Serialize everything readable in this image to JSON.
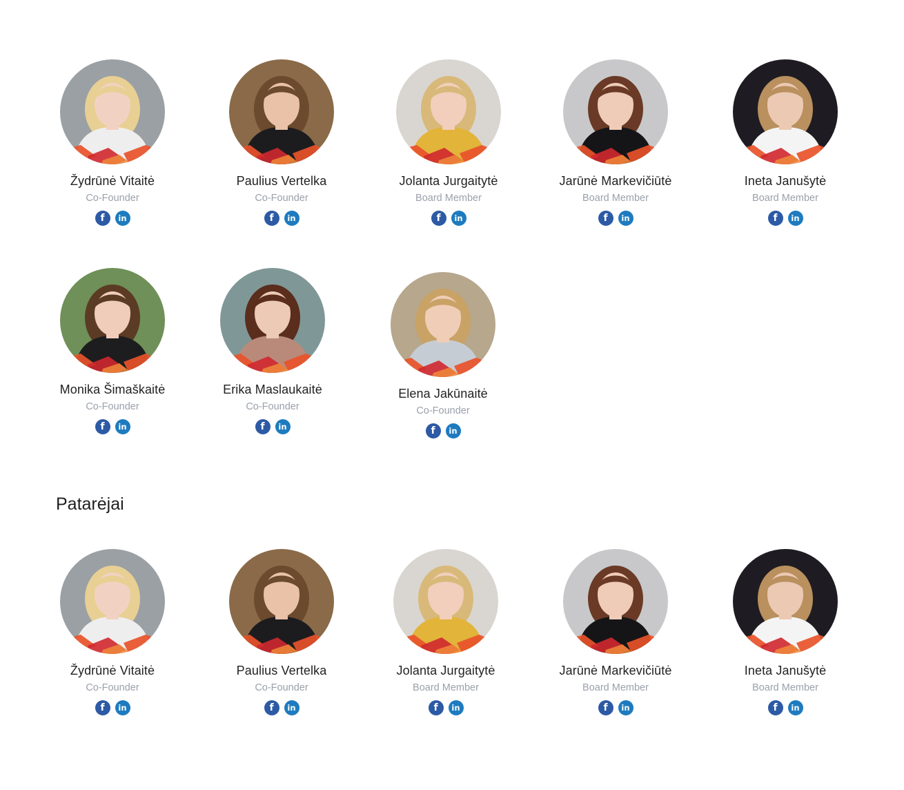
{
  "board": [
    {
      "name": "Žydrūnė Vitaitė",
      "role": "Co-Founder",
      "bg": "#9aa0a4",
      "skin": "#f1d2c2",
      "hair": "#e8cf93",
      "cloth": "#eeeeee"
    },
    {
      "name": "Paulius Vertelka",
      "role": "Co-Founder",
      "bg": "#8a6a48",
      "skin": "#e9c2a8",
      "hair": "#6b4a2d",
      "cloth": "#1c1c1f"
    },
    {
      "name": "Jolanta Jurgaitytė",
      "role": "Board Member",
      "bg": "#d9d6d1",
      "skin": "#f1cfbc",
      "hair": "#d9b97a",
      "cloth": "#e2b43a"
    },
    {
      "name": "Jarūnė Markevičiūtė",
      "role": "Board Member",
      "bg": "#c8c8ca",
      "skin": "#efccb8",
      "hair": "#6a3a26",
      "cloth": "#151517"
    },
    {
      "name": "Ineta Janušytė",
      "role": "Board Member",
      "bg": "#1e1c22",
      "skin": "#ecc9b3",
      "hair": "#b9905e",
      "cloth": "#f4f4f4"
    },
    {
      "name": "Monika Šimaškaitė",
      "role": "Co-Founder",
      "bg": "#6f9058",
      "skin": "#f0cdbb",
      "hair": "#5b3b24",
      "cloth": "#1d1d1f"
    },
    {
      "name": "Erika Maslaukaitė",
      "role": "Co-Founder",
      "bg": "#7f9897",
      "skin": "#eccab6",
      "hair": "#5a2d1d",
      "cloth": "#b98a7a"
    },
    {
      "name": "Elena Jakūnaitė",
      "role": "Co-Founder",
      "bg": "#b6a78d",
      "skin": "#efcdb6",
      "hair": "#c9a266",
      "cloth": "#c6ccd4"
    }
  ],
  "advisors_title": "Patarėjai",
  "advisors": [
    {
      "name": "Žydrūnė Vitaitė",
      "role": "Co-Founder",
      "bg": "#9aa0a4",
      "skin": "#f1d2c2",
      "hair": "#e8cf93",
      "cloth": "#eeeeee"
    },
    {
      "name": "Paulius Vertelka",
      "role": "Co-Founder",
      "bg": "#8a6a48",
      "skin": "#e9c2a8",
      "hair": "#6b4a2d",
      "cloth": "#1c1c1f"
    },
    {
      "name": "Jolanta Jurgaitytė",
      "role": "Board Member",
      "bg": "#d9d6d1",
      "skin": "#f1cfbc",
      "hair": "#d9b97a",
      "cloth": "#e2b43a"
    },
    {
      "name": "Jarūnė Markevičiūtė",
      "role": "Board Member",
      "bg": "#c8c8ca",
      "skin": "#efccb8",
      "hair": "#6a3a26",
      "cloth": "#151517"
    },
    {
      "name": "Ineta Janušytė",
      "role": "Board Member",
      "bg": "#1e1c22",
      "skin": "#ecc9b3",
      "hair": "#b9905e",
      "cloth": "#f4f4f4"
    }
  ],
  "social": {
    "facebook_glyph": "f",
    "linkedin_glyph": "in"
  },
  "colors": {
    "facebook": "#2d5aa5",
    "linkedin": "#1e7bbf",
    "accent_orange": "#e8532a",
    "accent_red": "#d0282f"
  }
}
